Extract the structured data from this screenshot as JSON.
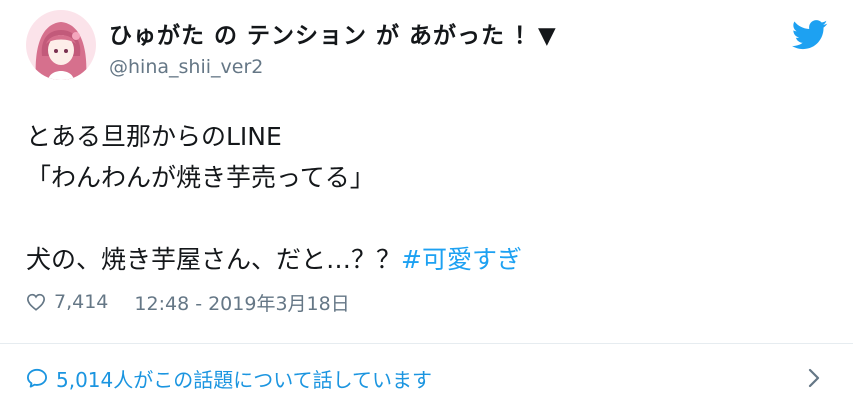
{
  "account": {
    "display_name": "ひゅがた の テンション が あがった ！▼",
    "handle": "@hina_shii_ver2"
  },
  "tweet": {
    "line1": "とある旦那からのLINE",
    "line2": "「わんわんが焼き芋売ってる」",
    "line3": "犬の、焼き芋屋さん、だと…？？",
    "hashtag": "#可愛すぎ"
  },
  "meta": {
    "likes": "7,414",
    "timestamp": "12:48 - 2019年3月18日"
  },
  "footer": {
    "discussion": "5,014人がこの話題について話しています"
  },
  "icons": {
    "avatar": "avatar-illustration",
    "brand": "twitter-bird-icon",
    "like": "heart-icon",
    "reply": "speech-bubble-icon",
    "more": "chevron-right-icon"
  },
  "colors": {
    "brand_blue": "#1da1f2",
    "link_blue": "#1b95e0",
    "secondary_text": "#657786"
  }
}
